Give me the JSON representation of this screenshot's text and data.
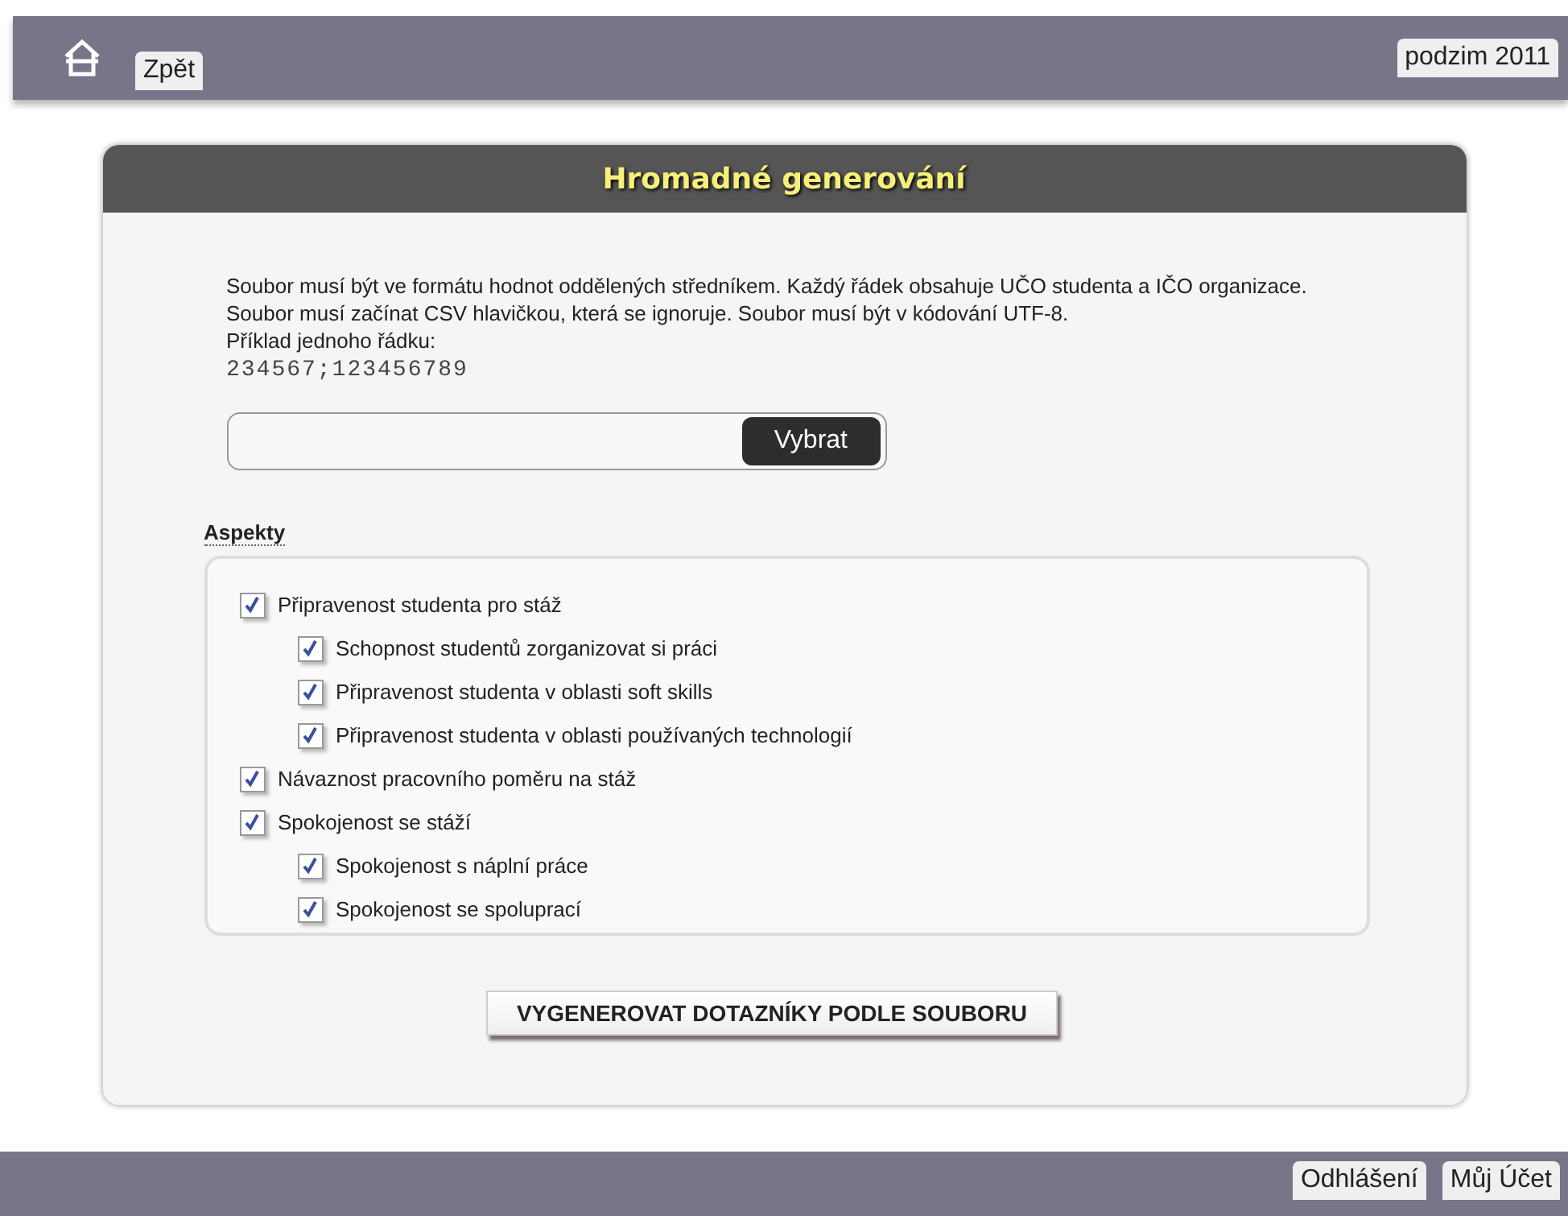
{
  "top_bar": {
    "back": "Zpět",
    "semester": "podzim 2011"
  },
  "panel": {
    "title": "Hromadné generování",
    "instructions": "Soubor musí být ve formátu hodnot oddělených středníkem. Každý řádek obsahuje UČO studenta a IČO organizace. Soubor musí začínat CSV hlavičkou, která se ignoruje. Soubor musí být v kódování UTF-8.",
    "example_label": "Příklad jednoho řádku:",
    "example": "234567;123456789",
    "file_button": "Vybrat",
    "aspects_heading": "Aspekty",
    "aspects": [
      {
        "label": "Připravenost studenta pro stáž",
        "checked": true,
        "children": [
          {
            "label": "Schopnost studentů zorganizovat si práci",
            "checked": true
          },
          {
            "label": "Připravenost studenta v oblasti soft skills",
            "checked": true
          },
          {
            "label": "Připravenost studenta v oblasti používaných technologií",
            "checked": true
          }
        ]
      },
      {
        "label": "Návaznost pracovního poměru na stáž",
        "checked": true
      },
      {
        "label": "Spokojenost se stáží",
        "checked": true,
        "children": [
          {
            "label": "Spokojenost s náplní práce",
            "checked": true
          },
          {
            "label": "Spokojenost se spoluprací",
            "checked": true
          }
        ]
      }
    ],
    "submit": "VYGENEROVAT DOTAZNÍKY PODLE SOUBORU"
  },
  "bottom_bar": {
    "buttons": [
      "Odhlášení",
      "Můj Účet"
    ]
  }
}
